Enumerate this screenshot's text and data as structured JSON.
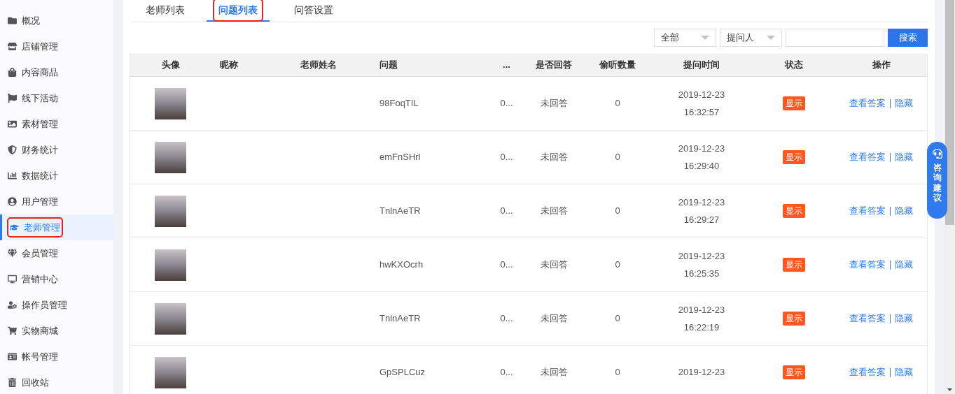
{
  "sidebar": {
    "items": [
      {
        "label": "概况",
        "selected": false,
        "highlighted": false
      },
      {
        "label": "店铺管理",
        "selected": false,
        "highlighted": false
      },
      {
        "label": "内容商品",
        "selected": false,
        "highlighted": false
      },
      {
        "label": "线下活动",
        "selected": false,
        "highlighted": false
      },
      {
        "label": "素材管理",
        "selected": false,
        "highlighted": false
      },
      {
        "label": "财务统计",
        "selected": false,
        "highlighted": false
      },
      {
        "label": "数据统计",
        "selected": false,
        "highlighted": false
      },
      {
        "label": "用户管理",
        "selected": false,
        "highlighted": false
      },
      {
        "label": "老师管理",
        "selected": true,
        "highlighted": true
      },
      {
        "label": "会员管理",
        "selected": false,
        "highlighted": false
      },
      {
        "label": "营销中心",
        "selected": false,
        "highlighted": false
      },
      {
        "label": "操作员管理",
        "selected": false,
        "highlighted": false
      },
      {
        "label": "实物商城",
        "selected": false,
        "highlighted": false
      },
      {
        "label": "帐号管理",
        "selected": false,
        "highlighted": false
      },
      {
        "label": "回收站",
        "selected": false,
        "highlighted": false
      }
    ]
  },
  "tabs": [
    {
      "label": "老师列表",
      "selected": false,
      "highlighted": false
    },
    {
      "label": "问题列表",
      "selected": true,
      "highlighted": true
    },
    {
      "label": "问答设置",
      "selected": false,
      "highlighted": false
    }
  ],
  "filters": {
    "status_select": "全部",
    "field_select": "提问人",
    "search_button": "搜索"
  },
  "table": {
    "columns": [
      "头像",
      "昵称",
      "老师姓名",
      "问题",
      "...",
      "是否回答",
      "偷听数量",
      "提问时间",
      "状态",
      "操作"
    ],
    "rows": [
      {
        "question": "98FoqTIL",
        "column_5": "0...",
        "answered": "未回答",
        "listen_count": "0",
        "date": "2019-12-23",
        "time": "16:32:57",
        "status": "显示",
        "actions": [
          "查看答案",
          "隐藏"
        ]
      },
      {
        "question": "emFnSHrl",
        "column_5": "0...",
        "answered": "未回答",
        "listen_count": "0",
        "date": "2019-12-23",
        "time": "16:29:40",
        "status": "显示",
        "actions": [
          "查看答案",
          "隐藏"
        ]
      },
      {
        "question": "TnlnAeTR",
        "column_5": "0...",
        "answered": "未回答",
        "listen_count": "0",
        "date": "2019-12-23",
        "time": "16:29:27",
        "status": "显示",
        "actions": [
          "查看答案",
          "隐藏"
        ]
      },
      {
        "question": "hwKXOcrh",
        "column_5": "0...",
        "answered": "未回答",
        "listen_count": "0",
        "date": "2019-12-23",
        "time": "16:25:35",
        "status": "显示",
        "actions": [
          "查看答案",
          "隐藏"
        ]
      },
      {
        "question": "TnlnAeTR",
        "column_5": "0...",
        "answered": "未回答",
        "listen_count": "0",
        "date": "2019-12-23",
        "time": "16:22:19",
        "status": "显示",
        "actions": [
          "查看答案",
          "隐藏"
        ]
      },
      {
        "question": "GpSPLCuz",
        "column_5": "0...",
        "answered": "未回答",
        "listen_count": "0",
        "date": "2019-12-23",
        "status": "显示",
        "actions": [
          "查看答案",
          "隐藏"
        ]
      }
    ]
  },
  "float_button": {
    "label": "咨询建议"
  }
}
